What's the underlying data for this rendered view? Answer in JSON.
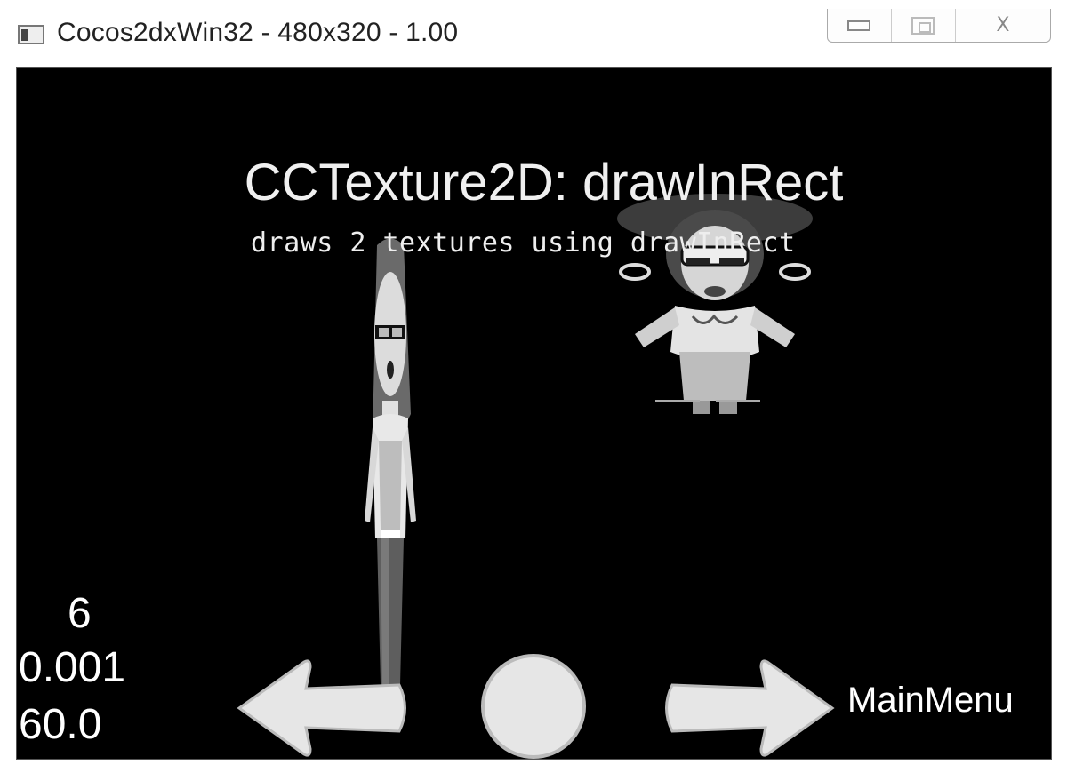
{
  "window": {
    "title": "Cocos2dxWin32 - 480x320 - 1.00",
    "controls": {
      "minimize_icon": "minimize-icon",
      "maximize_icon": "maximize-icon",
      "close_icon": "close-icon",
      "close_glyph": "X"
    }
  },
  "scene": {
    "title": "CCTexture2D: drawInRect",
    "subtitle": "draws 2 textures using drawInRect",
    "background": "#000000"
  },
  "stats": {
    "draw_calls": "6",
    "seconds_per_frame": "0.001",
    "fps": "60.0"
  },
  "navigation": {
    "back_icon": "left-arrow-icon",
    "restart_icon": "circle-restart-icon",
    "next_icon": "right-arrow-icon",
    "main_menu_label": "MainMenu"
  },
  "sprites": {
    "stretched_sprite": "grossini-dance-sprite-stretched",
    "normal_sprite": "grossini-dance-sprite"
  }
}
